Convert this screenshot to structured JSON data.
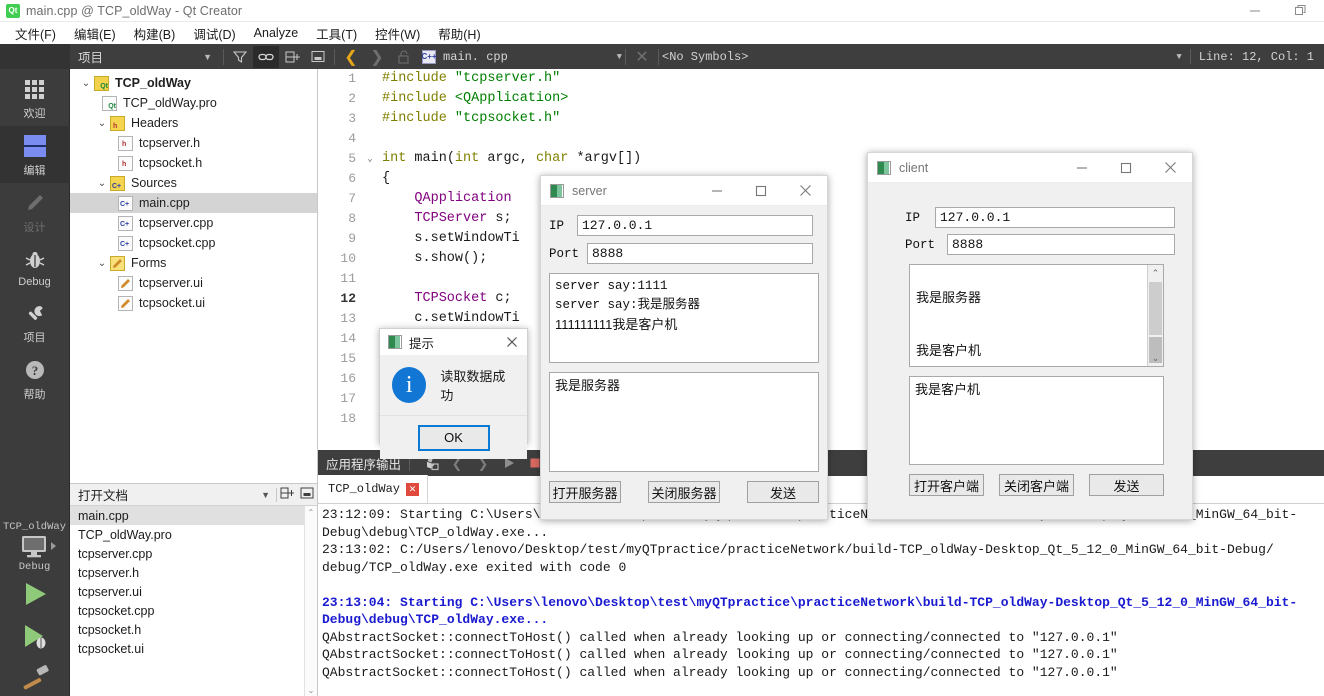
{
  "window": {
    "title": "main.cpp @ TCP_oldWay - Qt Creator",
    "logo_text": "Qt",
    "minimize": "—",
    "restore": "❐"
  },
  "menu": [
    {
      "label": "文件(F)",
      "key": "F"
    },
    {
      "label": "编辑(E)",
      "key": "E"
    },
    {
      "label": "构建(B)",
      "key": "B"
    },
    {
      "label": "调试(D)",
      "key": "D"
    },
    {
      "label": "Analyze",
      "key": "A"
    },
    {
      "label": "工具(T)",
      "key": "T"
    },
    {
      "label": "控件(W)",
      "key": "W"
    },
    {
      "label": "帮助(H)",
      "key": "H"
    }
  ],
  "toolbar": {
    "project_combo": "项目",
    "filter_icon": "filter-icon",
    "link_icon": "link-icon",
    "split_icon": "split-icon",
    "close_split_icon": "close-split-icon",
    "back_icon": "back-arrow-icon",
    "forward_icon": "forward-arrow-icon",
    "lock_icon": "unlock-icon",
    "file_combo": "main. cpp",
    "file_badge": "C++",
    "close_file_icon": "close-icon",
    "symbols_combo": "<No Symbols>",
    "line_col": "Line: 12, Col: 1"
  },
  "modes": [
    {
      "label": "欢迎",
      "icon": "grid-icon",
      "state": "normal"
    },
    {
      "label": "编辑",
      "icon": "document-icon",
      "state": "selected"
    },
    {
      "label": "设计",
      "icon": "pencil-icon",
      "state": "disabled"
    },
    {
      "label": "Debug",
      "icon": "bug-icon",
      "state": "normal"
    },
    {
      "label": "项目",
      "icon": "wrench-icon",
      "state": "normal"
    },
    {
      "label": "帮助",
      "icon": "question-icon",
      "state": "normal"
    }
  ],
  "kit": {
    "project_name": "TCP_oldWay",
    "build_config": "Debug",
    "target_icon": "desktop-icon",
    "run_icon": "run-triangle-icon",
    "debug_icon": "debug-run-icon",
    "build_icon": "hammer-icon"
  },
  "project_tree": {
    "items": [
      {
        "label": "TCP_oldWay",
        "depth": 0,
        "twisty": "v",
        "icon": "qt-project-icon",
        "bold": true,
        "selected": false
      },
      {
        "label": "TCP_oldWay.pro",
        "depth": 1,
        "twisty": "",
        "icon": "pro-file-icon",
        "bold": false,
        "selected": false
      },
      {
        "label": "Headers",
        "depth": 1,
        "twisty": "v",
        "icon": "headers-folder-icon",
        "bold": false,
        "selected": false
      },
      {
        "label": "tcpserver.h",
        "depth": 2,
        "twisty": "",
        "icon": "h-file-icon",
        "bold": false,
        "selected": false
      },
      {
        "label": "tcpsocket.h",
        "depth": 2,
        "twisty": "",
        "icon": "h-file-icon",
        "bold": false,
        "selected": false
      },
      {
        "label": "Sources",
        "depth": 1,
        "twisty": "v",
        "icon": "sources-folder-icon",
        "bold": false,
        "selected": false
      },
      {
        "label": "main.cpp",
        "depth": 2,
        "twisty": "",
        "icon": "cpp-file-icon",
        "bold": false,
        "selected": true
      },
      {
        "label": "tcpserver.cpp",
        "depth": 2,
        "twisty": "",
        "icon": "cpp-file-icon",
        "bold": false,
        "selected": false
      },
      {
        "label": "tcpsocket.cpp",
        "depth": 2,
        "twisty": "",
        "icon": "cpp-file-icon",
        "bold": false,
        "selected": false
      },
      {
        "label": "Forms",
        "depth": 1,
        "twisty": "v",
        "icon": "forms-folder-icon",
        "bold": false,
        "selected": false
      },
      {
        "label": "tcpserver.ui",
        "depth": 2,
        "twisty": "",
        "icon": "ui-file-icon",
        "bold": false,
        "selected": false
      },
      {
        "label": "tcpsocket.ui",
        "depth": 2,
        "twisty": "",
        "icon": "ui-file-icon",
        "bold": false,
        "selected": false
      }
    ]
  },
  "open_documents": {
    "title": "打开文档",
    "items": [
      {
        "label": "main.cpp",
        "selected": true
      },
      {
        "label": "TCP_oldWay.pro",
        "selected": false
      },
      {
        "label": "tcpserver.cpp",
        "selected": false
      },
      {
        "label": "tcpserver.h",
        "selected": false
      },
      {
        "label": "tcpserver.ui",
        "selected": false
      },
      {
        "label": "tcpsocket.cpp",
        "selected": false
      },
      {
        "label": "tcpsocket.h",
        "selected": false
      },
      {
        "label": "tcpsocket.ui",
        "selected": false
      }
    ]
  },
  "editor": {
    "lines": [
      {
        "n": "1",
        "fold": "",
        "segs": [
          {
            "t": "#include ",
            "c": "k-pre"
          },
          {
            "t": "\"tcpserver.h\"",
            "c": "k-str"
          }
        ]
      },
      {
        "n": "2",
        "fold": "",
        "segs": [
          {
            "t": "#include ",
            "c": "k-pre"
          },
          {
            "t": "<QApplication>",
            "c": "k-str"
          }
        ]
      },
      {
        "n": "3",
        "fold": "",
        "segs": [
          {
            "t": "#include ",
            "c": "k-pre"
          },
          {
            "t": "\"tcpsocket.h\"",
            "c": "k-str"
          }
        ]
      },
      {
        "n": "4",
        "fold": "",
        "segs": []
      },
      {
        "n": "5",
        "fold": "v",
        "segs": [
          {
            "t": "int",
            "c": "k-key"
          },
          {
            "t": " main(",
            "c": "k-plain"
          },
          {
            "t": "int",
            "c": "k-key"
          },
          {
            "t": " argc, ",
            "c": "k-plain"
          },
          {
            "t": "char",
            "c": "k-key"
          },
          {
            "t": " *argv[])",
            "c": "k-plain"
          }
        ]
      },
      {
        "n": "6",
        "fold": "",
        "segs": [
          {
            "t": "{",
            "c": "k-plain"
          }
        ]
      },
      {
        "n": "7",
        "fold": "",
        "segs": [
          {
            "t": "    QApplication",
            "c": "k-type"
          }
        ]
      },
      {
        "n": "8",
        "fold": "",
        "segs": [
          {
            "t": "    TCPServer",
            "c": "k-type"
          },
          {
            "t": " s;",
            "c": "k-plain"
          }
        ]
      },
      {
        "n": "9",
        "fold": "",
        "segs": [
          {
            "t": "    s.setWindowTi",
            "c": "k-plain"
          }
        ]
      },
      {
        "n": "10",
        "fold": "",
        "segs": [
          {
            "t": "    s.show();",
            "c": "k-plain"
          }
        ]
      },
      {
        "n": "11",
        "fold": "",
        "segs": []
      },
      {
        "n": "12",
        "fold": "",
        "segs": [
          {
            "t": "    TCPSocket",
            "c": "k-type"
          },
          {
            "t": " c;",
            "c": "k-plain"
          }
        ],
        "current": true
      },
      {
        "n": "13",
        "fold": "",
        "segs": [
          {
            "t": "    c.setWindowTi",
            "c": "k-plain"
          }
        ]
      },
      {
        "n": "14",
        "fold": "",
        "segs": []
      },
      {
        "n": "15",
        "fold": "",
        "segs": []
      },
      {
        "n": "16",
        "fold": "",
        "segs": []
      },
      {
        "n": "17",
        "fold": "",
        "segs": []
      },
      {
        "n": "18",
        "fold": "",
        "segs": []
      }
    ]
  },
  "output": {
    "title": "应用程序输出",
    "clear_icon": "clear-icon",
    "prev_icon": "prev-icon",
    "next_icon": "next-icon",
    "run_icon": "run-icon",
    "stop_icon": "stop-icon",
    "tab_label": "TCP_oldWay",
    "tab_close_icon": "close-icon",
    "lines": [
      {
        "text": "23:12:09: Starting C:\\Users\\lenovo\\Desktop\\test\\myQTpractice\\practiceNetwork\\build-TCP_oldWay-Desktop_Qt_5_12_0_MinGW_64_bit-",
        "blue": false
      },
      {
        "text": "Debug\\debug\\TCP_oldWay.exe...",
        "blue": false
      },
      {
        "text": "23:13:02: C:/Users/lenovo/Desktop/test/myQTpractice/practiceNetwork/build-TCP_oldWay-Desktop_Qt_5_12_0_MinGW_64_bit-Debug/",
        "blue": false
      },
      {
        "text": "debug/TCP_oldWay.exe exited with code 0",
        "blue": false
      },
      {
        "text": "",
        "blue": false
      },
      {
        "text": "23:13:04: Starting C:\\Users\\lenovo\\Desktop\\test\\myQTpractice\\practiceNetwork\\build-TCP_oldWay-Desktop_Qt_5_12_0_MinGW_64_bit-",
        "blue": true
      },
      {
        "text": "Debug\\debug\\TCP_oldWay.exe...",
        "blue": true
      },
      {
        "text": "QAbstractSocket::connectToHost() called when already looking up or connecting/connected to \"127.0.0.1\"",
        "blue": false
      },
      {
        "text": "QAbstractSocket::connectToHost() called when already looking up or connecting/connected to \"127.0.0.1\"",
        "blue": false
      },
      {
        "text": "QAbstractSocket::connectToHost() called when already looking up or connecting/connected to \"127.0.0.1\"",
        "blue": false
      }
    ]
  },
  "server_window": {
    "title": "server",
    "minimize": "—",
    "maximize": "□",
    "close": "✕",
    "ip_label": "IP",
    "ip_value": "127.0.0.1",
    "port_label": "Port",
    "port_value": "8888",
    "receive_lines": [
      {
        "text": "server say:1111",
        "mono": true
      },
      {
        "text": "server say:我是服务器",
        "mono": true
      },
      {
        "text": "111111111我是客户机",
        "mono": false
      }
    ],
    "send_text": "我是服务器",
    "buttons": [
      {
        "label": "打开服务器",
        "name": "open-server-button"
      },
      {
        "label": "关闭服务器",
        "name": "close-server-button"
      },
      {
        "label": "发送",
        "name": "send-button"
      }
    ]
  },
  "client_window": {
    "title": "client",
    "minimize": "—",
    "maximize": "□",
    "close": "✕",
    "ip_label": "IP",
    "ip_value": "127.0.0.1",
    "port_label": "Port",
    "port_value": "8888",
    "receive_lines": [
      "我是服务器",
      "我是客户机"
    ],
    "send_text": "我是客户机",
    "scroll_up": "˄",
    "scroll_down": "˅",
    "buttons": [
      {
        "label": "打开客户端",
        "name": "open-client-button"
      },
      {
        "label": "关闭客户端",
        "name": "close-client-button"
      },
      {
        "label": "发送",
        "name": "send-button"
      }
    ]
  },
  "message_box": {
    "title": "提示",
    "close": "✕",
    "icon": "info-icon",
    "icon_glyph": "i",
    "message": "读取数据成功",
    "ok_label": "OK"
  },
  "colors": {
    "accent_blue": "#1277d4",
    "qt_green": "#41cd52",
    "toolbar_dark": "#3e3e3e",
    "mode_bar": "#3c3c3c",
    "selection_gray": "#d4d4d4",
    "output_blue": "#1a1ad0",
    "error_red": "#e04a3c"
  }
}
